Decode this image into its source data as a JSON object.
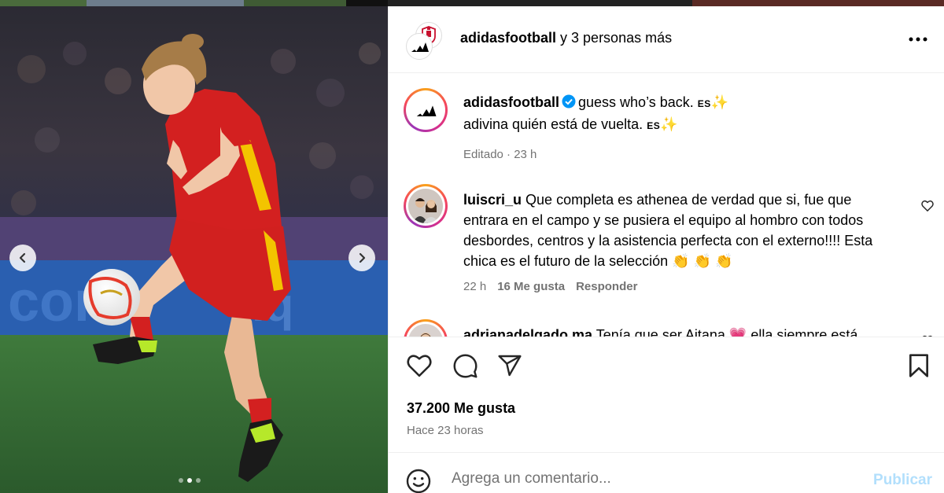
{
  "header": {
    "username": "adidasfootball",
    "others_text": "y 3 personas más",
    "more_icon": "more-horizontal-icon"
  },
  "caption": {
    "username": "adidasfootball",
    "line1": "guess who’s back.",
    "line1_lang": "ES",
    "line2": "adivina quién está de vuelta.",
    "line2_lang": "ES",
    "sparkle": "✨",
    "edited": "Editado · 23 h"
  },
  "comments": [
    {
      "username": "luiscri_u",
      "text": "Que completa es athenea de verdad que si, fue que entrara en el campo y se pusiera el equipo al hombro con todos desbordes, centros y la asistencia perfecta con el externo!!!! Esta chica es el futuro de la selección",
      "emojis": "👏 👏 👏",
      "time": "22 h",
      "likes": "16 Me gusta",
      "reply": "Responder"
    },
    {
      "username": "adrianadelgado.ma",
      "text": "Tenía que ser Aitana",
      "emoji": "💗",
      "text2": "ella siempre está"
    }
  ],
  "actions": {
    "likes": "37.200 Me gusta",
    "time_ago": "Hace 23 horas"
  },
  "comment_box": {
    "placeholder": "Agrega un comentario...",
    "publish": "Publicar"
  },
  "colors": {
    "publish_disabled": "#b2dffc",
    "verified": "#0095f6",
    "secondary_text": "#737373",
    "heart": "#e11d48"
  }
}
